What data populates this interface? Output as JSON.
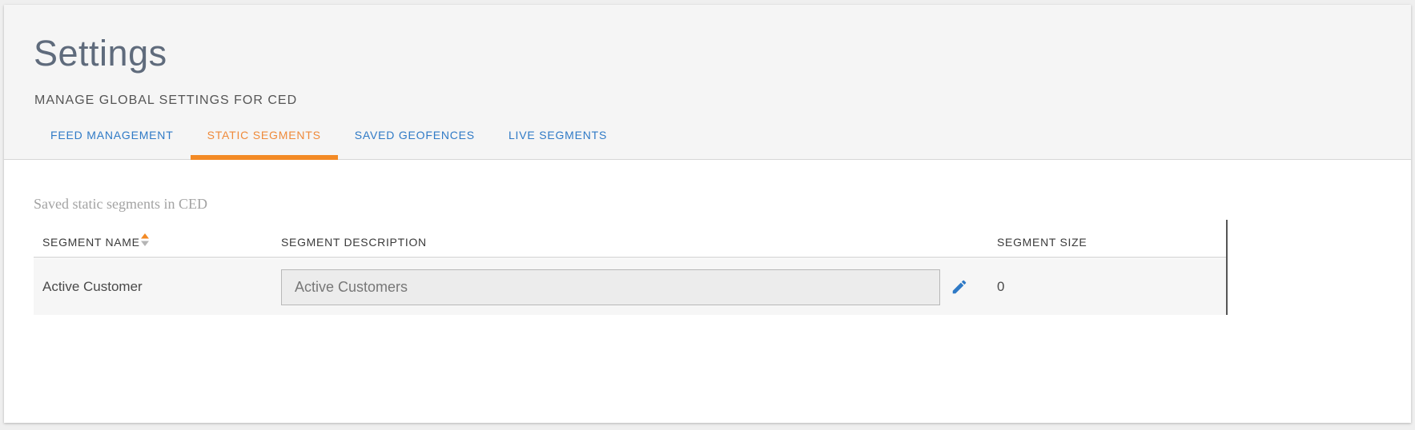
{
  "page": {
    "title": "Settings",
    "subtitle": "MANAGE GLOBAL SETTINGS FOR CED"
  },
  "tabs": [
    {
      "label": "FEED MANAGEMENT",
      "active": false
    },
    {
      "label": "STATIC SEGMENTS",
      "active": true
    },
    {
      "label": "SAVED GEOFENCES",
      "active": false
    },
    {
      "label": "LIVE SEGMENTS",
      "active": false
    }
  ],
  "section": {
    "title": "Saved static segments in CED"
  },
  "table": {
    "columns": {
      "name": "SEGMENT NAME",
      "description": "SEGMENT DESCRIPTION",
      "size": "SEGMENT SIZE"
    },
    "rows": [
      {
        "name": "Active Customer",
        "description": "Active Customers",
        "size": "0"
      }
    ]
  },
  "icons": {
    "sort": "sort-icon",
    "edit": "pencil-edit-icon"
  },
  "colors": {
    "accent_orange": "#f38a25",
    "tab_active_text": "#ef8a3a",
    "tab_link": "#2f7ac6",
    "edit_icon": "#2f7ac6"
  }
}
